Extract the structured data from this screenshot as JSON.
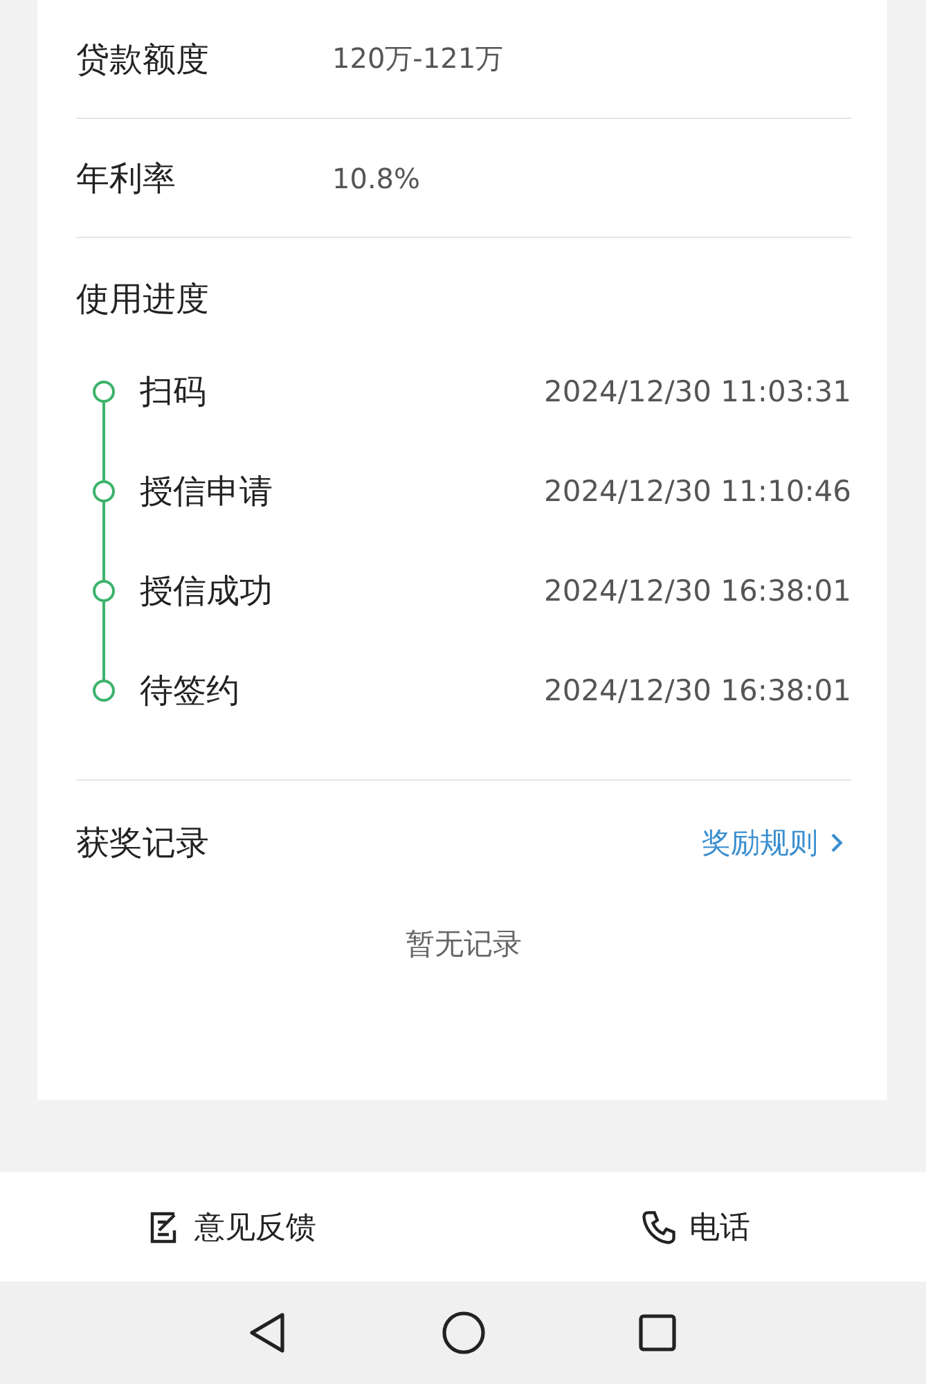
{
  "details": [
    {
      "label": "贷款额度",
      "value": "120万-121万"
    },
    {
      "label": "年利率",
      "value": "10.8%"
    }
  ],
  "progress": {
    "title": "使用进度",
    "steps": [
      {
        "name": "扫码",
        "time": "2024/12/30 11:03:31"
      },
      {
        "name": "授信申请",
        "time": "2024/12/30 11:10:46"
      },
      {
        "name": "授信成功",
        "time": "2024/12/30 16:38:01"
      },
      {
        "name": "待签约",
        "time": "2024/12/30 16:38:01"
      }
    ]
  },
  "rewards": {
    "title": "获奖记录",
    "link": "奖励规则",
    "empty": "暂无记录"
  },
  "bottom_bar": [
    {
      "kind": "feedback",
      "label": "意见反馈"
    },
    {
      "kind": "phone",
      "label": "电话"
    }
  ]
}
